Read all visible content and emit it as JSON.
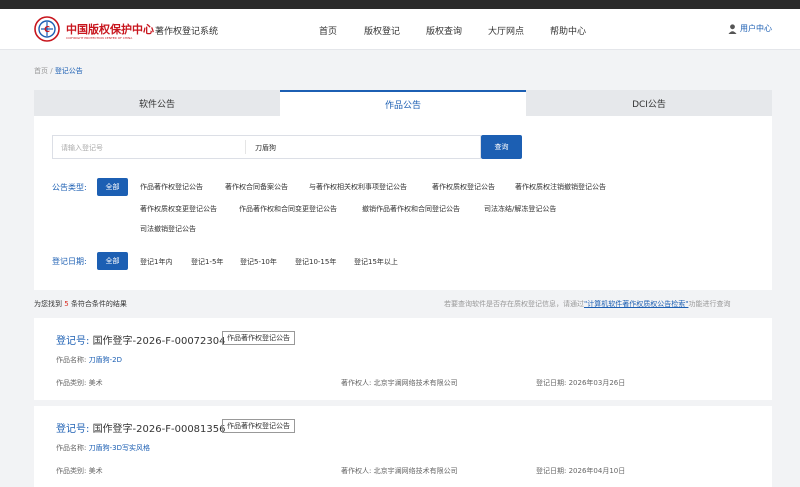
{
  "header": {
    "logo_cn": "中国版权保护中心",
    "logo_en": "COPYRIGHT PROTECTION CENTER OF CHINA",
    "system_name": "著作权登记系统",
    "nav": [
      "首页",
      "版权登记",
      "版权查询",
      "大厅网点",
      "帮助中心"
    ],
    "user_label": "用户中心"
  },
  "breadcrumb": {
    "home": "首页",
    "sep": " / ",
    "current": "登记公告"
  },
  "tabs": [
    "软件公告",
    "作品公告",
    "DCI公告"
  ],
  "active_tab": 1,
  "search": {
    "placeholder": "请输入登记号",
    "keyword": "刀盾狗",
    "button": "查询"
  },
  "filters": {
    "type_label": "公告类型:",
    "all": "全部",
    "types": [
      "作品著作权登记公告",
      "著作权合同备案公告",
      "与著作权相关权利事项登记公告",
      "著作权质权登记公告",
      "著作权质权注销撤销登记公告",
      "著作权质权变更登记公告",
      "作品著作权和合同变更登记公告",
      "撤销作品著作权和合同登记公告",
      "司法冻结/解冻登记公告",
      "司法撤销登记公告"
    ],
    "date_label": "登记日期:",
    "dates": [
      "登记1年内",
      "登记1-5年",
      "登记5-10年",
      "登记10-15年",
      "登记15年以上"
    ]
  },
  "result": {
    "prefix": "为您找到",
    "count": "5",
    "suffix": "条符合条件的结果",
    "hint_prefix": "若要查询软件是否存在质权登记信息，请通过",
    "hint_link": "\"计算机软件著作权质权公告检索\"",
    "hint_suffix": "功能进行查询"
  },
  "cards": [
    {
      "reg_label": "登记号:",
      "reg_no": "国作登字-2026-F-00072304",
      "tag": "作品著作权登记公告",
      "name_label": "作品名称:",
      "name": "刀盾狗-2D",
      "category_label": "作品类别:",
      "category": "美术",
      "owner_label": "著作权人:",
      "owner": "北京宇澜网络技术有限公司",
      "date_label": "登记日期:",
      "date": "2026年03月26日"
    },
    {
      "reg_label": "登记号:",
      "reg_no": "国作登字-2026-F-00081356",
      "tag": "作品著作权登记公告",
      "name_label": "作品名称:",
      "name": "刀盾狗-3D写实风格",
      "category_label": "作品类别:",
      "category": "美术",
      "owner_label": "著作权人:",
      "owner": "北京宇澜网络技术有限公司",
      "date_label": "登记日期:",
      "date": "2026年04月10日"
    }
  ],
  "colors": {
    "accent": "#1c5fb3",
    "brand_red": "#c8161e",
    "count_red": "#d93025"
  }
}
